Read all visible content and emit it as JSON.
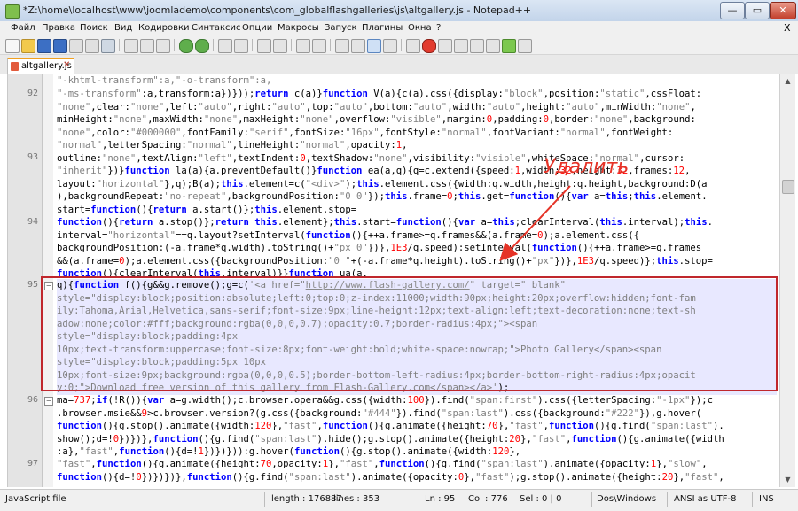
{
  "window": {
    "title": "*Z:\\home\\localhost\\www\\joomlademo\\components\\com_globalflashgalleries\\js\\altgallery.js - Notepad++",
    "min": "—",
    "max": "▭",
    "close": "✕"
  },
  "menu": {
    "items": [
      "Файл",
      "Правка",
      "Поиск",
      "Вид",
      "Кодировки",
      "Синтаксис",
      "Опции",
      "Макросы",
      "Запуск",
      "Плагины",
      "Окна",
      "?"
    ],
    "close": "X"
  },
  "tab": {
    "label": "altgallery.js",
    "close": "✕"
  },
  "lines": {
    "l91_tail": "\"-khtml-transform\":a,\"-o-transform\":a,",
    "l92": "92",
    "l93": "93",
    "l94": "94",
    "l95": "95",
    "l96": "96",
    "l97": "97"
  },
  "annotation": {
    "label": "Удалить"
  },
  "status": {
    "type": "JavaScript file",
    "length": "length : 176887",
    "lines": "lines : 353",
    "ln": "Ln : 95",
    "col": "Col : 776",
    "sel": "Sel : 0 | 0",
    "eol": "Dos\\Windows",
    "enc": "ANSI as UTF-8",
    "mode": "INS"
  },
  "colors": {
    "keyword": "#0000ff",
    "string": "#808080",
    "number": "#ff0000",
    "annotation": "#e53327",
    "highlight": "#e8e8ff"
  }
}
